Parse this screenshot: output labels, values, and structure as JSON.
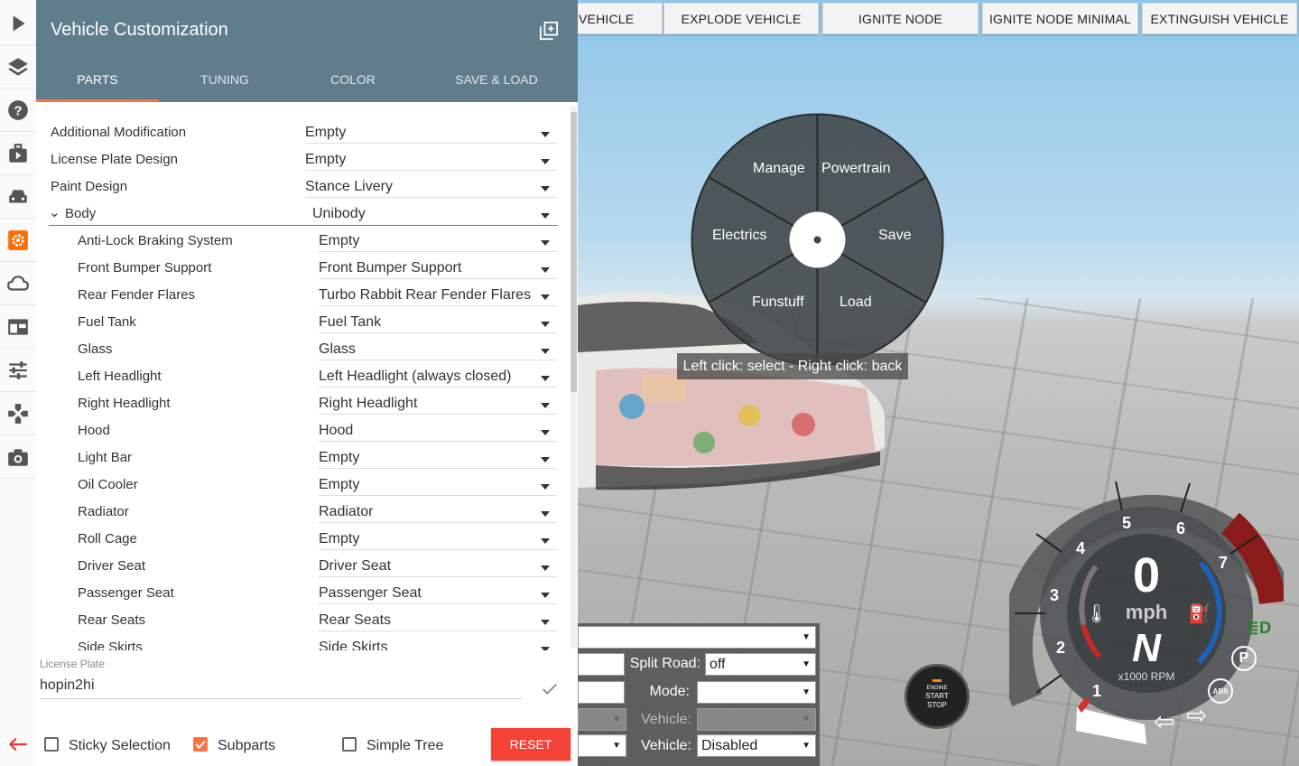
{
  "topbar": {
    "buttons": [
      "VEHICLE",
      "EXPLODE VEHICLE",
      "IGNITE NODE",
      "IGNITE NODE MINIMAL",
      "EXTINGUISH VEHICLE"
    ]
  },
  "radial_menu": {
    "items": [
      "Manage",
      "Powertrain",
      "Electrics",
      "Save",
      "Funstuff",
      "Load"
    ],
    "hint": "Left click: select - Right click: back"
  },
  "bottom_panel": {
    "split_road_label": "Split Road:",
    "split_road_value": "off",
    "mode_label": "Mode:",
    "mode_value": "",
    "vehicle_label_1": "Vehicle:",
    "vehicle_label_2": "Vehicle:",
    "vehicle_value": "Disabled"
  },
  "engine_button": {
    "line1": "ENGINE",
    "line2": "START",
    "line3": "STOP"
  },
  "gauge": {
    "speed": "0",
    "unit": "mph",
    "gear": "N",
    "rpm_label": "x1000 RPM",
    "ticks": [
      "1",
      "2",
      "3",
      "4",
      "5",
      "6",
      "7"
    ],
    "parking": "P",
    "abs": "ABS"
  },
  "panel": {
    "title": "Vehicle Customization",
    "tabs": [
      "PARTS",
      "TUNING",
      "COLOR",
      "SAVE & LOAD"
    ],
    "parts": [
      {
        "name": "Additional Modification",
        "value": "Empty",
        "level": 0
      },
      {
        "name": "License Plate Design",
        "value": "Empty",
        "level": 0
      },
      {
        "name": "Paint Design",
        "value": "Stance Livery",
        "level": 0
      },
      {
        "name": "Body",
        "value": "Unibody",
        "level": 0,
        "expanded": true
      },
      {
        "name": "Anti-Lock Braking System",
        "value": "Empty",
        "level": 1
      },
      {
        "name": "Front Bumper Support",
        "value": "Front Bumper Support",
        "level": 1
      },
      {
        "name": "Rear Fender Flares",
        "value": "Turbo Rabbit Rear Fender Flares",
        "level": 1
      },
      {
        "name": "Fuel Tank",
        "value": "Fuel Tank",
        "level": 1
      },
      {
        "name": "Glass",
        "value": "Glass",
        "level": 1
      },
      {
        "name": "Left Headlight",
        "value": "Left Headlight (always closed)",
        "level": 1
      },
      {
        "name": "Right Headlight",
        "value": "Right Headlight",
        "level": 1
      },
      {
        "name": "Hood",
        "value": "Hood",
        "level": 1
      },
      {
        "name": "Light Bar",
        "value": "Empty",
        "level": 1
      },
      {
        "name": "Oil Cooler",
        "value": "Empty",
        "level": 1
      },
      {
        "name": "Radiator",
        "value": "Radiator",
        "level": 1
      },
      {
        "name": "Roll Cage",
        "value": "Empty",
        "level": 1
      },
      {
        "name": "Driver Seat",
        "value": "Driver Seat",
        "level": 1
      },
      {
        "name": "Passenger Seat",
        "value": "Passenger Seat",
        "level": 1
      },
      {
        "name": "Rear Seats",
        "value": "Rear Seats",
        "level": 1
      },
      {
        "name": "Side Skirts",
        "value": "Side Skirts",
        "level": 1
      }
    ],
    "license_plate_label": "License Plate",
    "license_plate_value": "hopin2hi",
    "sticky_selection_label": "Sticky Selection",
    "subparts_label": "Subparts",
    "simple_tree_label": "Simple Tree",
    "reset_label": "RESET"
  },
  "colors": {
    "header": "#607d8b",
    "accent": "#ff7043",
    "reset": "#f44336"
  }
}
